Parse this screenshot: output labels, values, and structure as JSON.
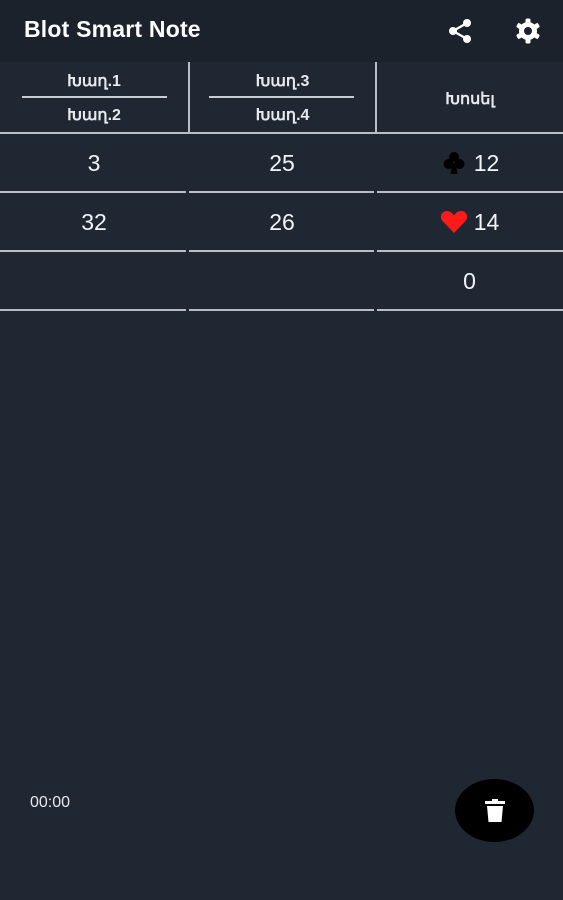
{
  "app": {
    "title": "Blot Smart Note",
    "actions": {
      "share_icon": "share-icon",
      "settings_icon": "gear-icon"
    }
  },
  "header": {
    "team1": {
      "player_a": "Խաղ.1",
      "player_b": "Խաղ.2"
    },
    "team2": {
      "player_a": "Խաղ.3",
      "player_b": "Խաղ.4"
    },
    "bid_label": "Խոսել"
  },
  "rows": [
    {
      "team1": "3",
      "team2": "25",
      "bid": "12",
      "suit": "clubs",
      "suit_color": "#000000"
    },
    {
      "team1": "32",
      "team2": "26",
      "bid": "14",
      "suit": "hearts",
      "suit_color": "#ff1a1a"
    },
    {
      "team1": "",
      "team2": "",
      "bid": "0",
      "suit": "",
      "suit_color": ""
    }
  ],
  "footer": {
    "timer": "00:00",
    "delete_icon": "trash-icon"
  },
  "colors": {
    "background": "#1f2733",
    "appbar": "#1b222c",
    "fab": "#000000"
  }
}
